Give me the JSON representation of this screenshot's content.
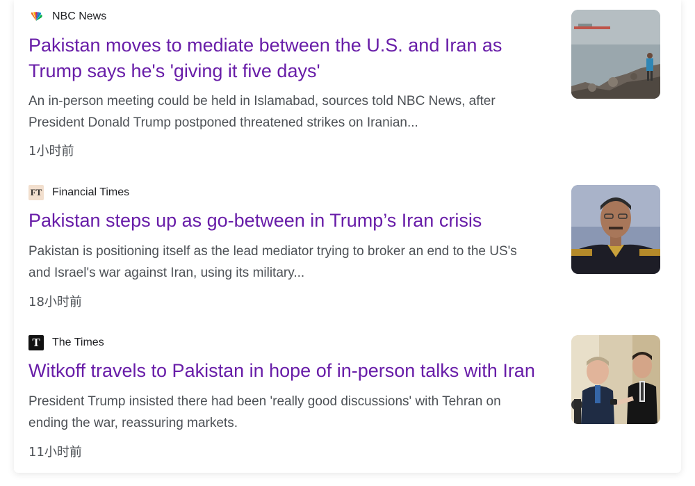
{
  "articles": [
    {
      "source": "NBC News",
      "source_icon": "nbc-peacock-icon",
      "headline_line1": "Pakistan moves to mediate between the U.S. and Iran as",
      "headline_line2": "Trump says he's 'giving it five days'",
      "snippet_line1": "An in-person meeting could be held in Islamabad, sources told NBC News, after",
      "snippet_line2": "President Donald Trump postponed threatened strikes on Iranian...",
      "time": "1小时前",
      "thumbnail": "harbor-rocks-photo"
    },
    {
      "source": "Financial Times",
      "source_icon": "ft-logo-icon",
      "source_logo_text": "FT",
      "headline_line1": "Pakistan steps up as go-between in Trump’s Iran crisis",
      "snippet_line1": "Pakistan is positioning itself as the lead mediator trying to broker an end to the US's",
      "snippet_line2": "and Israel's war against Iran, using its military...",
      "time": "18小时前",
      "thumbnail": "military-officer-portrait-photo"
    },
    {
      "source": "The Times",
      "source_icon": "the-times-logo-icon",
      "source_logo_text": "T",
      "headline_line1": "Witkoff travels to Pakistan in hope of in-person talks with Iran",
      "snippet_line1": "President Trump insisted there had been 'really good discussions' with Tehran on",
      "snippet_line2": "ending the war, reassuring markets.",
      "time": "11小时前",
      "thumbnail": "press-briefing-photo"
    }
  ],
  "colors": {
    "headline": "#681da8",
    "snippet": "#4d5156",
    "source": "#202124"
  }
}
